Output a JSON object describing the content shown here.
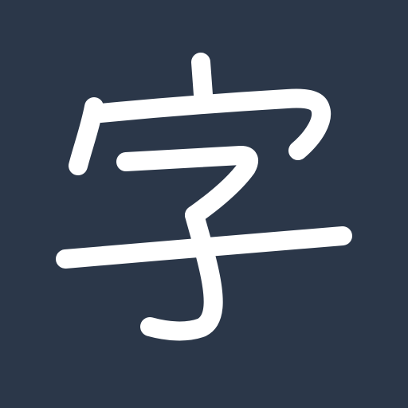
{
  "app_icon": {
    "character": "字",
    "background_color": "#2b3749",
    "glyph_color": "#ffffff",
    "icon_name": "kanji-ji-icon"
  }
}
